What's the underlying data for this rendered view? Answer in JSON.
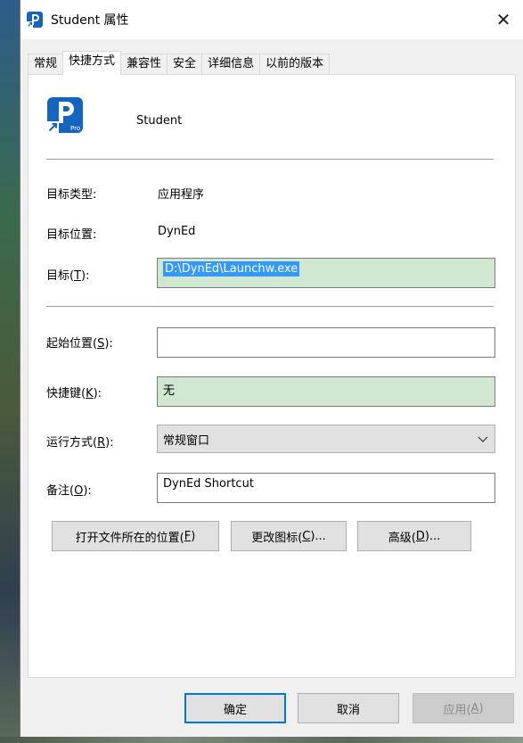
{
  "window": {
    "title": "Student 属性",
    "close_glyph": "✕"
  },
  "tabs": [
    {
      "label": "常规"
    },
    {
      "label": "快捷方式"
    },
    {
      "label": "兼容性"
    },
    {
      "label": "安全"
    },
    {
      "label": "详细信息"
    },
    {
      "label": "以前的版本"
    }
  ],
  "shortcut": {
    "app_name": "Student",
    "icon_letter": "P",
    "icon_badge": "Pro",
    "target_type_label": "目标类型:",
    "target_type_value": "应用程序",
    "target_location_label": "目标位置:",
    "target_location_value": "DynEd",
    "target_label_pre": "目标(",
    "target_label_key": "T",
    "target_label_post": "):",
    "target_value": "D:\\DynEd\\Launchw.exe",
    "start_in_label_pre": "起始位置(",
    "start_in_label_key": "S",
    "start_in_label_post": "):",
    "start_in_value": "",
    "hotkey_label_pre": "快捷键(",
    "hotkey_label_key": "K",
    "hotkey_label_post": "):",
    "hotkey_value": "无",
    "run_label_pre": "运行方式(",
    "run_label_key": "R",
    "run_label_post": "):",
    "run_value": "常规窗口",
    "comment_label_pre": "备注(",
    "comment_label_key": "O",
    "comment_label_post": "):",
    "comment_value": "DynEd Shortcut"
  },
  "actions": {
    "open_location_pre": "打开文件所在的位置(",
    "open_location_key": "F",
    "open_location_post": ")",
    "change_icon_pre": "更改图标(",
    "change_icon_key": "C",
    "change_icon_post": ")...",
    "advanced_pre": "高级(",
    "advanced_key": "D",
    "advanced_post": ")..."
  },
  "footer": {
    "ok": "确定",
    "cancel": "取消",
    "apply_pre": "应用(",
    "apply_key": "A",
    "apply_post": ")"
  },
  "colors": {
    "accent": "#0078d7",
    "icon_blue": "#1565c0",
    "field_green": "#cfe8cf",
    "selection": "#3399ff"
  }
}
